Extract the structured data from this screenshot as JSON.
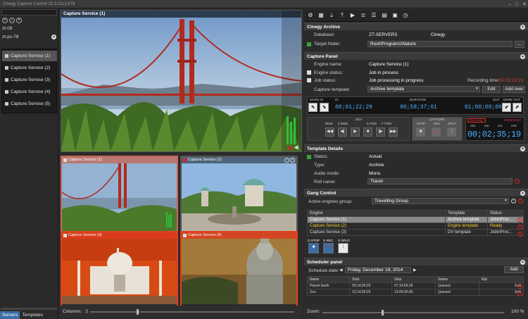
{
  "window": {
    "title": "Cinegy Capture Control 10.3.2113.879"
  },
  "left": {
    "search_placeholder": "",
    "servers": [
      "zt-09",
      "zt-pc-78"
    ],
    "services": [
      "Capture Service (1)",
      "Capture Service (2)",
      "Capture Service (3)",
      "Capture Service (4)",
      "Capture Service (5)"
    ],
    "tabs": [
      "Servers",
      "Templates"
    ]
  },
  "center": {
    "main_title": "Capture Service (1)",
    "tiles": [
      "Capture Service (1)",
      "Capture Service (2)",
      "Capture Service (3)",
      "Capture Service (4)"
    ],
    "columns_label": "Columns:",
    "columns_value": "2"
  },
  "archive": {
    "header": "Cinegy Archive",
    "database_label": "Database:",
    "database_value": "ZT-SERVER3",
    "db_name": "Cinegy",
    "target_label": "Target folder:",
    "target_value": "Root\\Programs\\Nature",
    "browse": "..."
  },
  "capture": {
    "header": "Capture Panel",
    "engine_name_label": "Engine name:",
    "engine_name_value": "Capture Service (1)",
    "engine_status_label": "Engine status:",
    "engine_status_value": "Job in process",
    "job_status_label": "Job status:",
    "job_status_value": "Job processing in progress",
    "rec_time_label": "Recording time:",
    "rec_time_value": "00:01:03:23",
    "template_label": "Capture template:",
    "template_value": "Archive template",
    "edit": "Edit",
    "add_new": "Add new",
    "mark_in": "MARK IN",
    "in": "IN",
    "duration": "DURATION",
    "out": "OUT",
    "mark_out": "MARK OUT",
    "tc_in": "00;01;22;29",
    "tc_duration": "00;58;37;01",
    "tc_out": "01;00;00;00",
    "dev": "DEV",
    "rew": "REW",
    "bwd5": "5 BWD",
    "fwd5": "5 FWD",
    "ffwd": "F FWD",
    "capture": "CAPTURE",
    "stop": "STOP",
    "rec": "REC",
    "split": "SPLIT",
    "recording": "Recording",
    "rec_small_tc": "00:01:03:23",
    "hrs": "HRS",
    "min": "MIN",
    "sec": "SEC",
    "frm": "FRM",
    "big_tc": "00;02;35;19"
  },
  "template_details": {
    "header": "Template Details",
    "status_label": "Status:",
    "status_value": "Actual",
    "type_label": "Type:",
    "type_value": "Archive",
    "audio_label": "Audio mode:",
    "audio_value": "Mono",
    "roll_label": "Roll name:",
    "roll_value": "Travel"
  },
  "gang": {
    "header": "Gang Control",
    "group_label": "Active engines group:",
    "group_value": "Travelling Group",
    "columns": [
      "Engine",
      "Template",
      "Status"
    ],
    "rows": [
      [
        "Capture Service (1)",
        "Archive template",
        "JobInProc..."
      ],
      [
        "Capture Service (2)",
        "Engine template",
        "Ready"
      ],
      [
        "Capture Service (3)",
        "DV template",
        "JobInProc..."
      ]
    ],
    "gstop": "G.STOP",
    "grec": "G.REC",
    "gsplit": "G.SPLIT"
  },
  "scheduler": {
    "header": "Scheduler panel",
    "date_label": "Schedule date:",
    "date_value": "Friday, December 19, 2014",
    "add": "Add",
    "columns": [
      "Name",
      "Start",
      "Stop",
      "Status",
      "Rpt"
    ],
    "rows": [
      [
        "Planet Earth",
        "09;14;59;29",
        "07;14;59;29",
        "Queued",
        "Edit"
      ],
      [
        "Zoo",
        "12;14;59;29",
        "13;00;00;00",
        "Queued",
        "Edit"
      ]
    ]
  },
  "zoom": {
    "label": "Zoom:",
    "value": "100 %"
  },
  "colors": {
    "accent": "#3a6ea5",
    "timecode": "#4fb0ff",
    "danger": "#d22222",
    "highlight": "#f0d030"
  }
}
